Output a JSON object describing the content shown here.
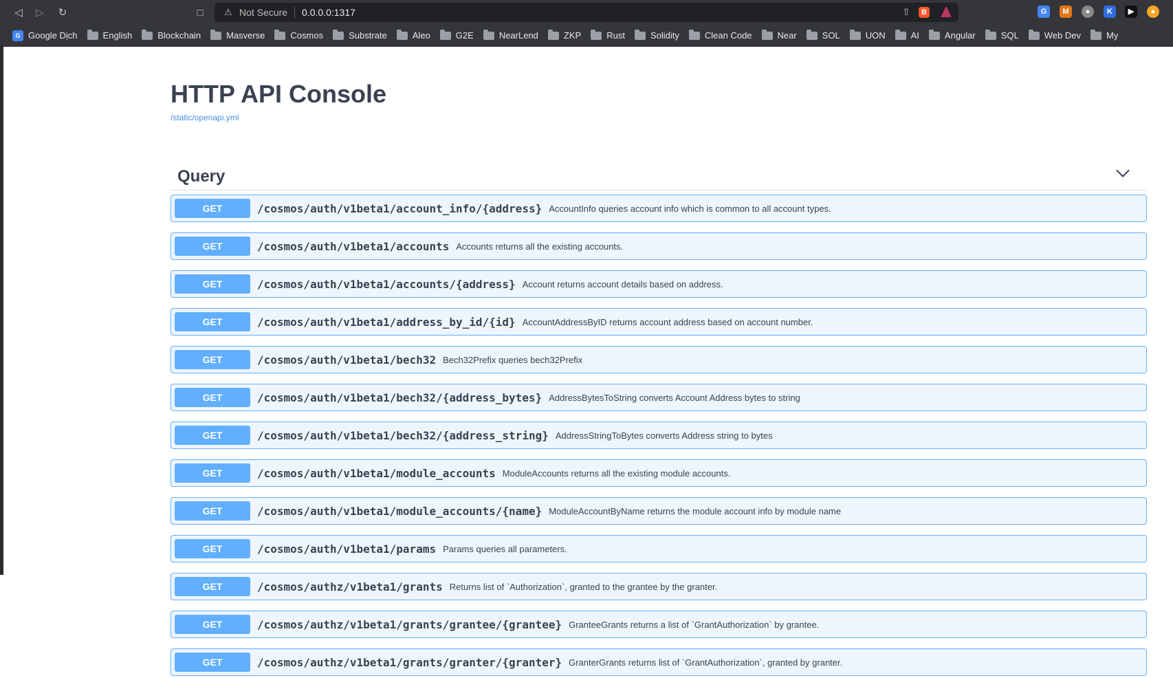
{
  "browser": {
    "security_label": "Not Secure",
    "url": "0.0.0.0:1317",
    "bookmarks": [
      {
        "label": "Google Dịch",
        "icon": "google-translate-icon"
      },
      {
        "label": "English",
        "icon": "folder-icon"
      },
      {
        "label": "Blockchain",
        "icon": "folder-icon"
      },
      {
        "label": "Masverse",
        "icon": "folder-icon"
      },
      {
        "label": "Cosmos",
        "icon": "folder-icon"
      },
      {
        "label": "Substrate",
        "icon": "folder-icon"
      },
      {
        "label": "Aleo",
        "icon": "folder-icon"
      },
      {
        "label": "G2E",
        "icon": "folder-icon"
      },
      {
        "label": "NearLend",
        "icon": "folder-icon"
      },
      {
        "label": "ZKP",
        "icon": "folder-icon"
      },
      {
        "label": "Rust",
        "icon": "folder-icon"
      },
      {
        "label": "Solidity",
        "icon": "folder-icon"
      },
      {
        "label": "Clean Code",
        "icon": "folder-icon"
      },
      {
        "label": "Near",
        "icon": "folder-icon"
      },
      {
        "label": "SOL",
        "icon": "folder-icon"
      },
      {
        "label": "UON",
        "icon": "folder-icon"
      },
      {
        "label": "AI",
        "icon": "folder-icon"
      },
      {
        "label": "Angular",
        "icon": "folder-icon"
      },
      {
        "label": "SQL",
        "icon": "folder-icon"
      },
      {
        "label": "Web Dev",
        "icon": "folder-icon"
      },
      {
        "label": "My",
        "icon": "folder-icon"
      }
    ]
  },
  "page": {
    "title": "HTTP API Console",
    "spec_link": "/static/openapi.yml"
  },
  "section": {
    "title": "Query"
  },
  "operations": [
    {
      "method": "GET",
      "path": "/cosmos/auth/v1beta1/account_info/{address}",
      "description": "AccountInfo queries account info which is common to all account types."
    },
    {
      "method": "GET",
      "path": "/cosmos/auth/v1beta1/accounts",
      "description": "Accounts returns all the existing accounts."
    },
    {
      "method": "GET",
      "path": "/cosmos/auth/v1beta1/accounts/{address}",
      "description": "Account returns account details based on address."
    },
    {
      "method": "GET",
      "path": "/cosmos/auth/v1beta1/address_by_id/{id}",
      "description": "AccountAddressByID returns account address based on account number."
    },
    {
      "method": "GET",
      "path": "/cosmos/auth/v1beta1/bech32",
      "description": "Bech32Prefix queries bech32Prefix"
    },
    {
      "method": "GET",
      "path": "/cosmos/auth/v1beta1/bech32/{address_bytes}",
      "description": "AddressBytesToString converts Account Address bytes to string"
    },
    {
      "method": "GET",
      "path": "/cosmos/auth/v1beta1/bech32/{address_string}",
      "description": "AddressStringToBytes converts Address string to bytes"
    },
    {
      "method": "GET",
      "path": "/cosmos/auth/v1beta1/module_accounts",
      "description": "ModuleAccounts returns all the existing module accounts."
    },
    {
      "method": "GET",
      "path": "/cosmos/auth/v1beta1/module_accounts/{name}",
      "description": "ModuleAccountByName returns the module account info by module name"
    },
    {
      "method": "GET",
      "path": "/cosmos/auth/v1beta1/params",
      "description": "Params queries all parameters."
    },
    {
      "method": "GET",
      "path": "/cosmos/authz/v1beta1/grants",
      "description": "Returns list of `Authorization`, granted to the grantee by the granter."
    },
    {
      "method": "GET",
      "path": "/cosmos/authz/v1beta1/grants/grantee/{grantee}",
      "description": "GranteeGrants returns a list of `GrantAuthorization` by grantee."
    },
    {
      "method": "GET",
      "path": "/cosmos/authz/v1beta1/grants/granter/{granter}",
      "description": "GranterGrants returns list of `GrantAuthorization`, granted by granter."
    }
  ],
  "colors": {
    "get_method": "#61affe",
    "get_row_bg": "#eef5fc",
    "text_dark": "#3b4151",
    "link": "#4990e2"
  }
}
